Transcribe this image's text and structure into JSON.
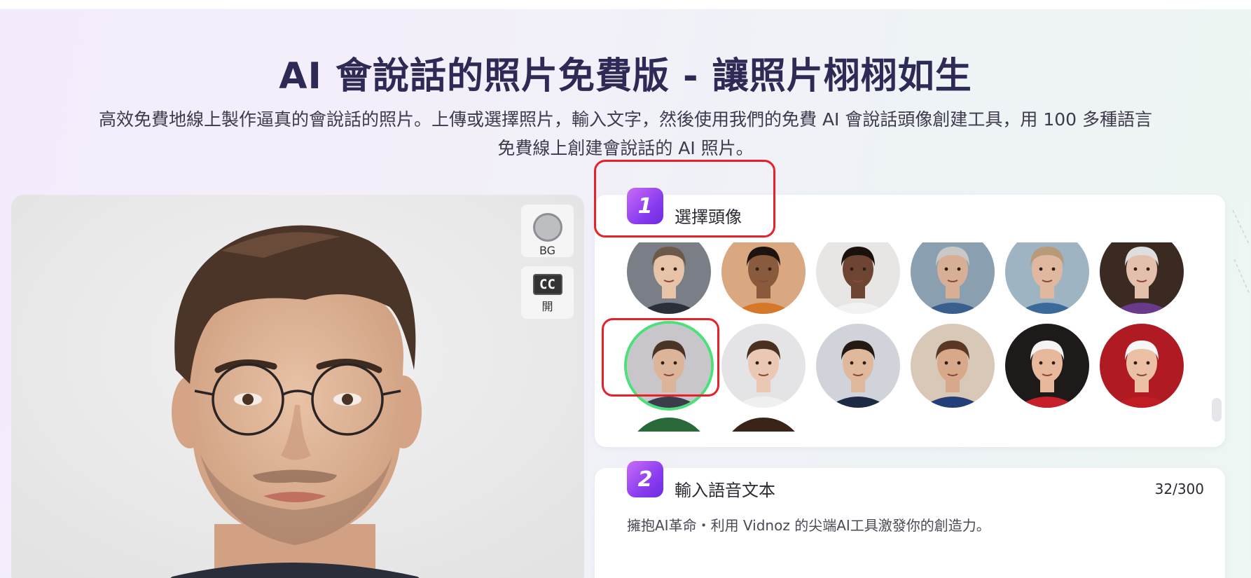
{
  "header": {
    "title": "AI 會說話的照片免費版 - 讓照片栩栩如生",
    "subtitle_line1": "高效免費地線上製作逼真的會說話的照片。上傳或選擇照片，輸入文字，然後使用我們的免費 AI 會說話頭像創建工具，用 100 多種語言",
    "subtitle_line2": "免費線上創建會說話的 AI 照片。"
  },
  "preview": {
    "bg_button_label": "BG",
    "cc_icon_text": "CC",
    "cc_button_label": "開"
  },
  "step1": {
    "number": "1",
    "title": "選擇頭像",
    "avatars": [
      {
        "name": "young-man-suit",
        "skin": "#e7c4a8",
        "hair": "#6b5a4a",
        "bg": "#7a7e86",
        "shirt": "#2a2f3a"
      },
      {
        "name": "man-orange-shirt",
        "skin": "#8a5a3c",
        "hair": "#1e140f",
        "bg": "#d9a880",
        "shirt": "#d6782a"
      },
      {
        "name": "woman-curly-hair",
        "skin": "#6e4532",
        "hair": "#1a110c",
        "bg": "#e8e6e4",
        "shirt": "#f2f2f2"
      },
      {
        "name": "older-man-doctor",
        "skin": "#d8ae94",
        "hair": "#c8c8c8",
        "bg": "#8aa0b0",
        "shirt": "#3a5e8e"
      },
      {
        "name": "older-woman",
        "skin": "#e0b8a0",
        "hair": "#b89a78",
        "bg": "#9eb4c2",
        "shirt": "#3a6a9a"
      },
      {
        "name": "elderly-woman-doctor",
        "skin": "#e4c0ac",
        "hair": "#dedede",
        "bg": "#3a2a22",
        "shirt": "#6a3a8a"
      },
      {
        "name": "man-glasses-selected",
        "skin": "#dcb49a",
        "hair": "#4a3426",
        "bg": "#c8c6ca",
        "shirt": "#3a3e4a"
      },
      {
        "name": "young-woman",
        "skin": "#eac8b4",
        "hair": "#4a3020",
        "bg": "#e4e4e6",
        "shirt": "#f0f0f0"
      },
      {
        "name": "man-business-suit",
        "skin": "#e0b89c",
        "hair": "#241a14",
        "bg": "#d0d4da",
        "shirt": "#1e2a44"
      },
      {
        "name": "woman-blazer",
        "skin": "#d8a88a",
        "hair": "#5a3826",
        "bg": "#d8c8b8",
        "shirt": "#243e78"
      },
      {
        "name": "santa-old-man",
        "skin": "#e8b89c",
        "hair": "#f4f4f4",
        "bg": "#1e1a1a",
        "shirt": "#c8202a"
      },
      {
        "name": "santa-claus",
        "skin": "#ecc0a4",
        "hair": "#f6f6f6",
        "bg": "#b01a22",
        "shirt": "#c01c24"
      },
      {
        "name": "christmas-avatar-1",
        "skin": "#e8b89c",
        "hair": "#c8202a",
        "bg": "#2a6a3a",
        "shirt": "#c8202a"
      },
      {
        "name": "christmas-avatar-2",
        "skin": "#e0b090",
        "hair": "#6a4030",
        "bg": "#3a2418",
        "shirt": "#7a4a30"
      }
    ]
  },
  "step2": {
    "number": "2",
    "title": "輸入語音文本",
    "counter": "32/300",
    "text": "擁抱AI革命・利用 Vidnoz 的尖端AI工具激發你的創造力。"
  },
  "colors": {
    "accent_purple": "#8b3cf0",
    "highlight_red": "#e8202a",
    "selected_green": "#4be07a",
    "title_color": "#2f2a55"
  }
}
